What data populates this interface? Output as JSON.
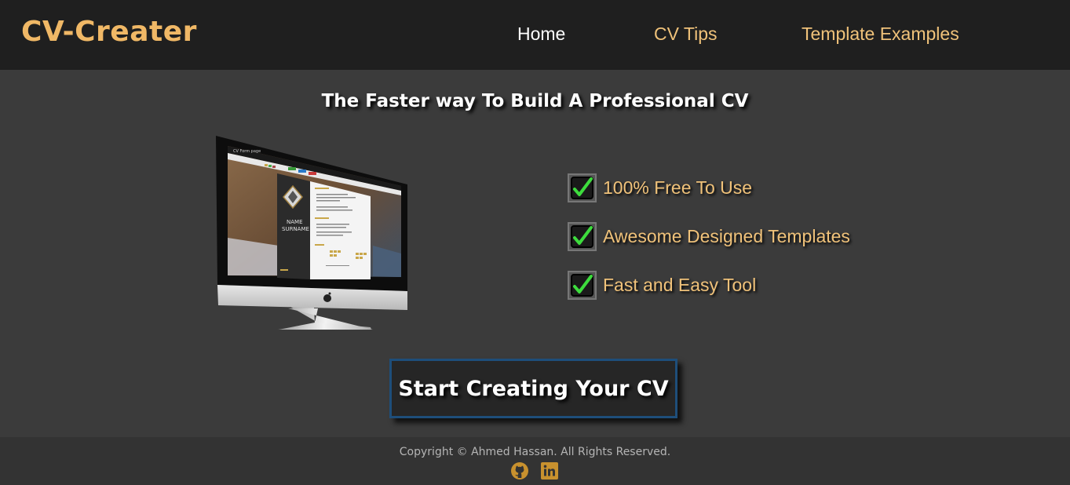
{
  "nav": {
    "logo": "CV-Creater",
    "links": [
      {
        "label": "Home"
      },
      {
        "label": "CV Tips"
      },
      {
        "label": "Template Examples"
      }
    ]
  },
  "hero": {
    "headline": "The Faster way To Build A Professional CV",
    "features": [
      {
        "label": "100% Free To Use",
        "icon": "checkbox-checked-icon"
      },
      {
        "label": "Awesome Designed Templates",
        "icon": "checkbox-checked-icon"
      },
      {
        "label": "Fast and Easy Tool",
        "icon": "checkbox-checked-icon"
      }
    ],
    "cta_label": "Start Creating Your CV",
    "preview": {
      "topbar": "CV Form page",
      "name_line1": "NAME",
      "name_line2": "SURNAME"
    }
  },
  "footer": {
    "copyright": "Copyright © Ahmed Hassan. All Rights Reserved.",
    "social": [
      {
        "icon": "github-icon"
      },
      {
        "icon": "linkedin-icon"
      }
    ]
  },
  "colors": {
    "accent": "#f0c27a",
    "logo": "#f0b866",
    "nav_bg": "#1f1f1f",
    "main_bg": "#3b3b3b",
    "footer_bg": "#333333",
    "cta_border": "#1e4e7a",
    "check": "#3ddc3d",
    "social_icon": "#c8912e"
  }
}
